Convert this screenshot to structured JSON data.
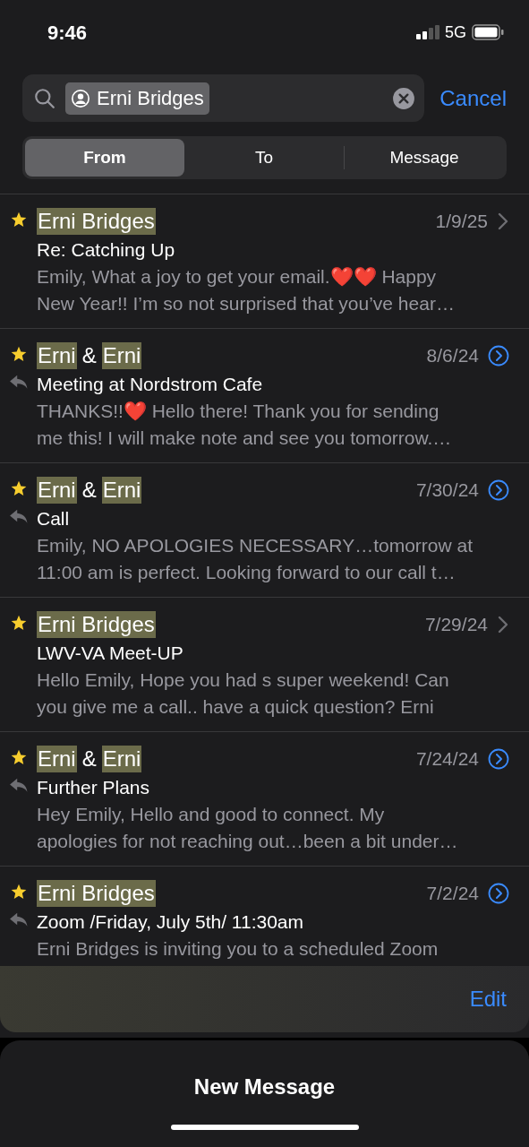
{
  "status_bar": {
    "time": "9:46",
    "network": "5G"
  },
  "search": {
    "token": "Erni Bridges",
    "cancel": "Cancel"
  },
  "scopes": [
    {
      "label": "From",
      "selected": true
    },
    {
      "label": "To",
      "selected": false
    },
    {
      "label": "Message",
      "selected": false
    }
  ],
  "messages": [
    {
      "sender": [
        {
          "text": "Erni Bridges",
          "highlighted": true
        }
      ],
      "starred": true,
      "replied": false,
      "kind": "single",
      "date": "1/9/25",
      "subject": "Re: Catching Up",
      "preview": [
        "Emily, What a joy to get your email.❤️❤️ Happy",
        "New Year!! I’m so not surprised that you’ve hear…"
      ]
    },
    {
      "sender": [
        {
          "text": "Erni",
          "highlighted": true
        },
        {
          "text": "&",
          "highlighted": false
        },
        {
          "text": "Erni",
          "highlighted": true
        }
      ],
      "starred": true,
      "replied": true,
      "kind": "thread",
      "date": "8/6/24",
      "subject": "Meeting at Nordstrom Cafe",
      "preview": [
        "THANKS!!❤️ Hello there! Thank you for sending",
        "me this! I will make note and see you tomorrow.…"
      ]
    },
    {
      "sender": [
        {
          "text": "Erni",
          "highlighted": true
        },
        {
          "text": "&",
          "highlighted": false
        },
        {
          "text": "Erni",
          "highlighted": true
        }
      ],
      "starred": true,
      "replied": true,
      "kind": "thread",
      "date": "7/30/24",
      "subject": "Call",
      "preview": [
        "Emily, NO APOLOGIES NECESSARY…tomorrow at",
        "11:00 am is perfect. Looking forward to our call t…"
      ]
    },
    {
      "sender": [
        {
          "text": "Erni Bridges",
          "highlighted": true
        }
      ],
      "starred": true,
      "replied": false,
      "kind": "single",
      "date": "7/29/24",
      "subject": "LWV-VA Meet-UP",
      "preview": [
        "Hello Emily, Hope you had s super weekend! Can",
        "you give me a call.. have a quick question? Erni"
      ]
    },
    {
      "sender": [
        {
          "text": "Erni",
          "highlighted": true
        },
        {
          "text": "&",
          "highlighted": false
        },
        {
          "text": "Erni",
          "highlighted": true
        }
      ],
      "starred": true,
      "replied": true,
      "kind": "thread",
      "date": "7/24/24",
      "subject": "Further Plans",
      "preview": [
        "Hey Emily, Hello and good to connect. My",
        "apologies for not reaching out…been a bit under…"
      ]
    },
    {
      "sender": [
        {
          "text": "Erni Bridges",
          "highlighted": true
        }
      ],
      "starred": true,
      "replied": true,
      "kind": "thread",
      "date": "7/2/24",
      "subject": "Zoom /Friday, July 5th/ 11:30am",
      "preview": [
        "Erni Bridges is inviting you to a scheduled Zoom"
      ]
    }
  ],
  "toolbar": {
    "edit": "Edit"
  },
  "compose": {
    "title": "New Message"
  }
}
